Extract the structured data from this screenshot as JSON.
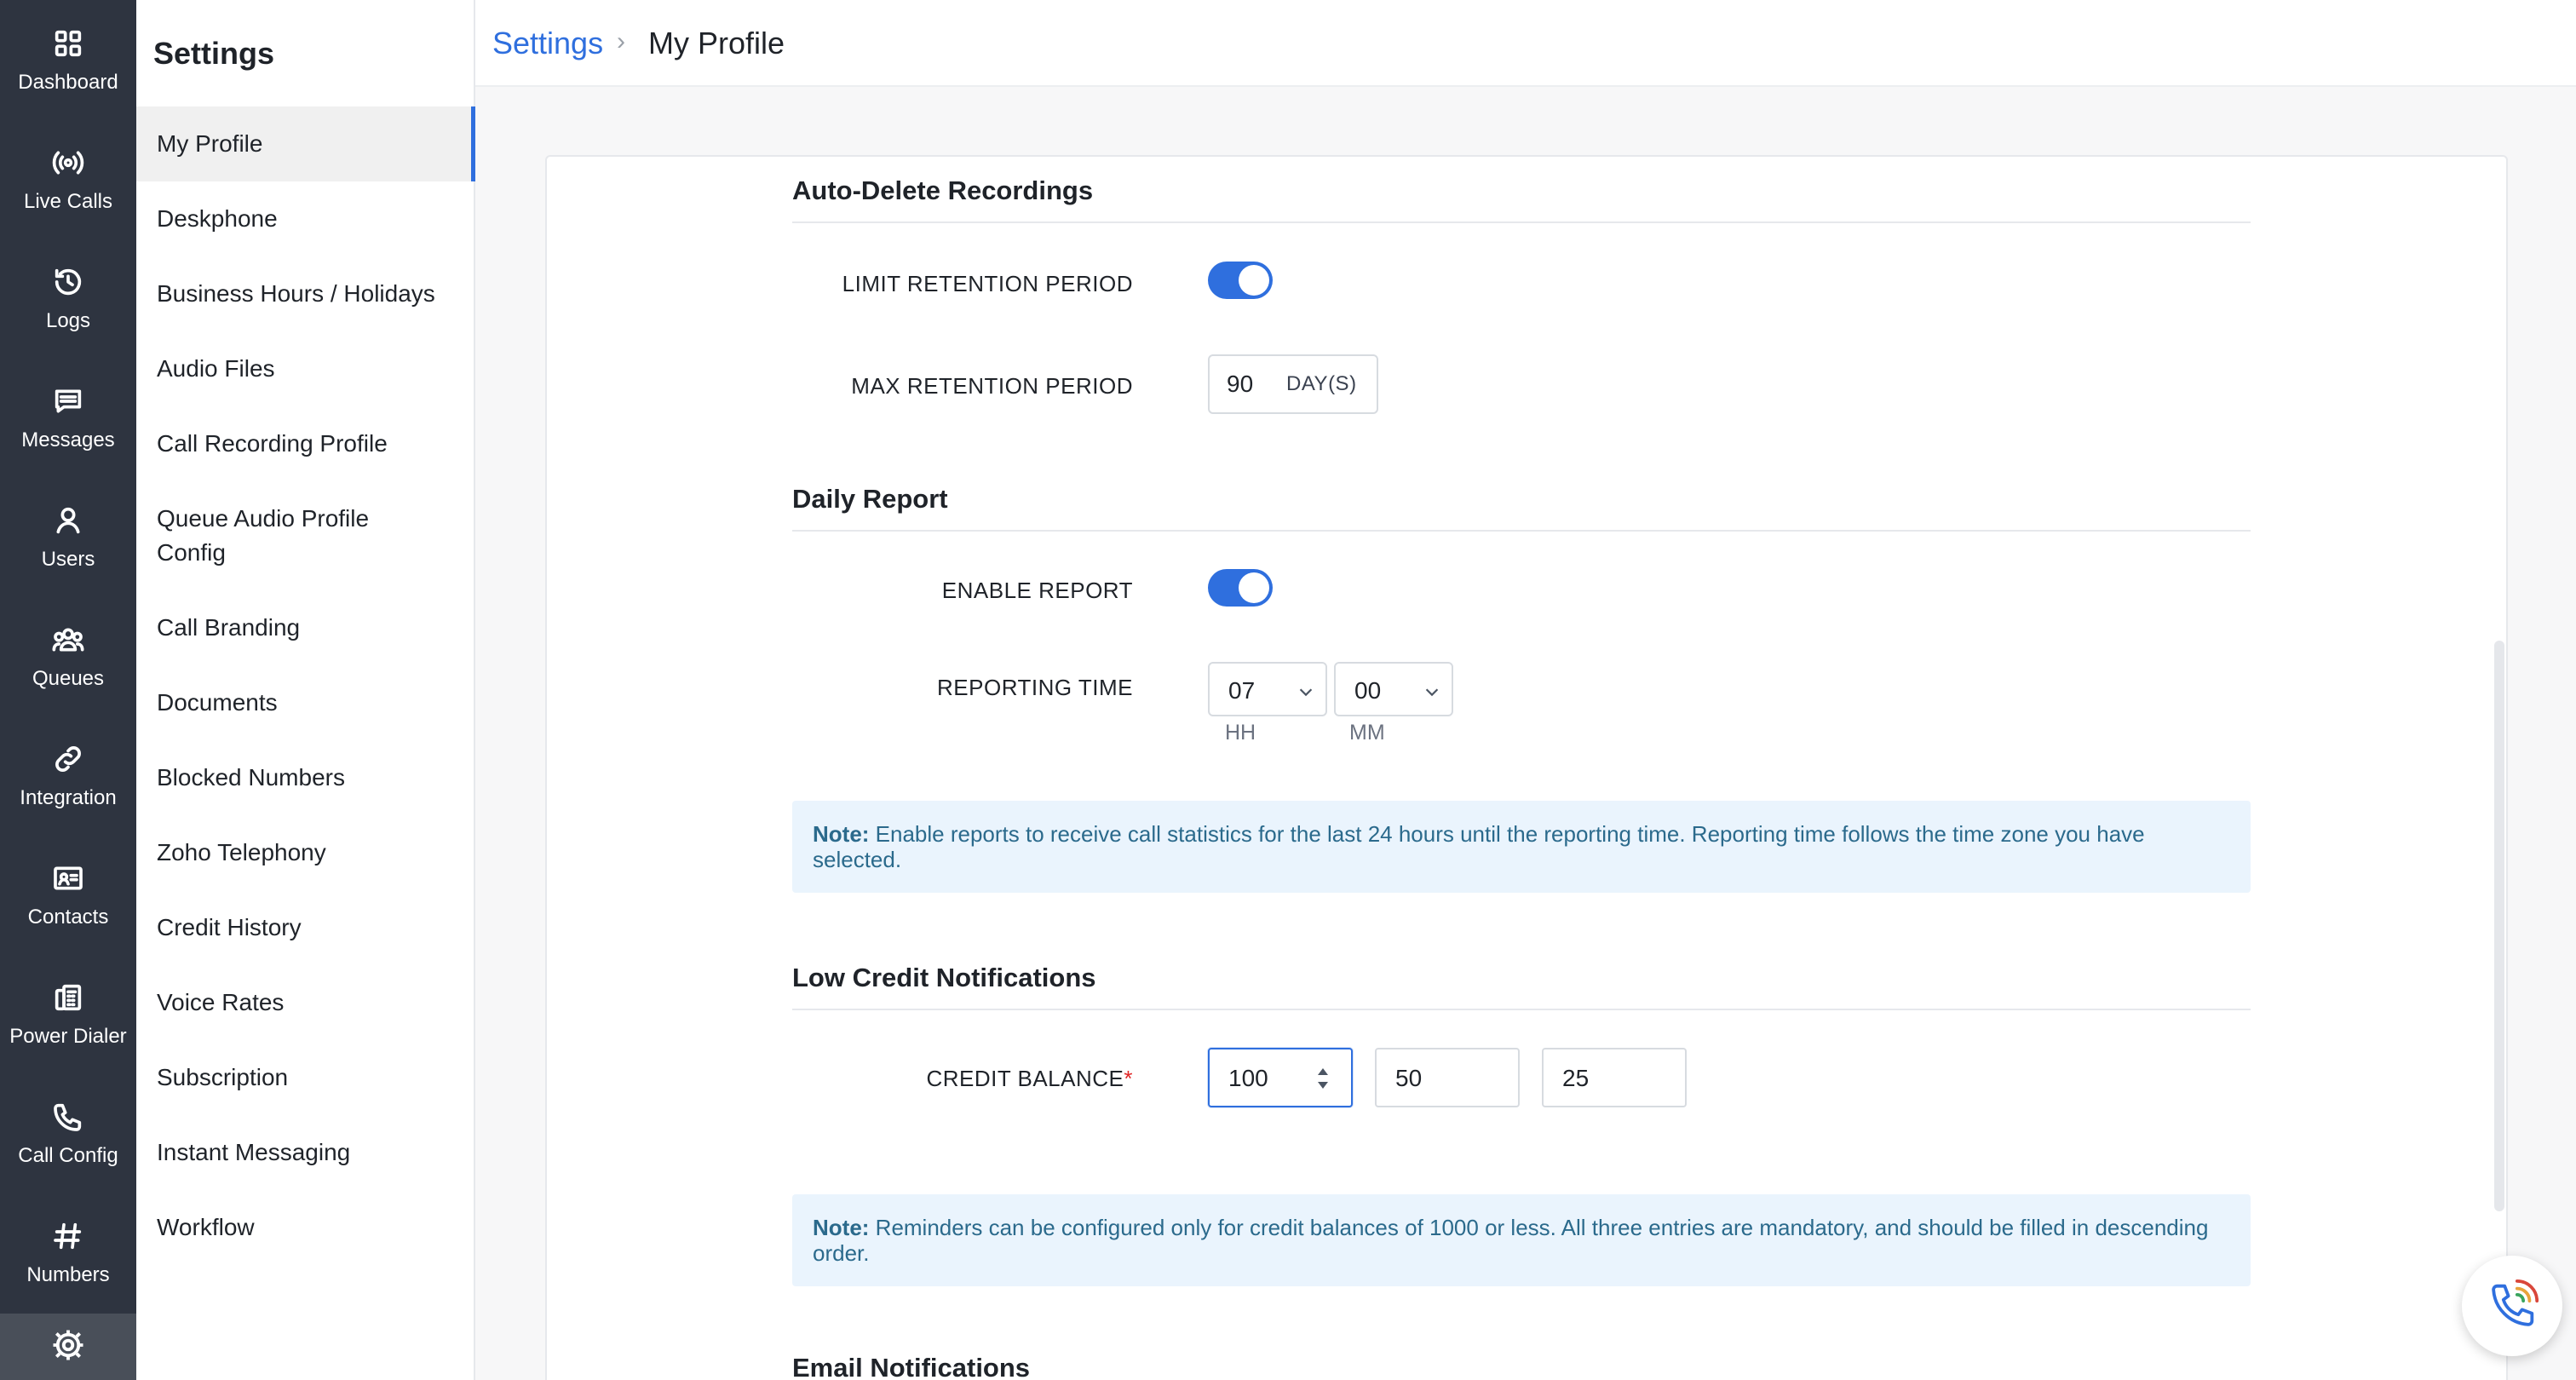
{
  "rail": {
    "items": [
      {
        "label": "Dashboard",
        "icon": "grid-icon"
      },
      {
        "label": "Live Calls",
        "icon": "broadcast-icon"
      },
      {
        "label": "Logs",
        "icon": "history-icon"
      },
      {
        "label": "Messages",
        "icon": "message-icon"
      },
      {
        "label": "Users",
        "icon": "user-icon"
      },
      {
        "label": "Queues",
        "icon": "group-icon"
      },
      {
        "label": "Integration",
        "icon": "link-icon"
      },
      {
        "label": "Contacts",
        "icon": "contact-card-icon"
      },
      {
        "label": "Power Dialer",
        "icon": "power-dialer-icon"
      },
      {
        "label": "Call Config",
        "icon": "phone-icon"
      },
      {
        "label": "Numbers",
        "icon": "hash-icon"
      }
    ],
    "settings_icon": "gear-icon"
  },
  "settings_nav": {
    "title": "Settings",
    "items": [
      "My Profile",
      "Deskphone",
      "Business Hours / Holidays",
      "Audio Files",
      "Call Recording Profile",
      "Queue Audio Profile Config",
      "Call Branding",
      "Documents",
      "Blocked Numbers",
      "Zoho Telephony",
      "Credit History",
      "Voice Rates",
      "Subscription",
      "Instant Messaging",
      "Workflow"
    ],
    "active": "My Profile"
  },
  "header": {
    "breadcrumb_root": "Settings",
    "breadcrumb_sep": "›",
    "breadcrumb_current": "My Profile"
  },
  "auto_delete": {
    "title": "Auto-Delete Recordings",
    "limit_label": "LIMIT RETENTION PERIOD",
    "limit_enabled": true,
    "max_label": "MAX RETENTION PERIOD",
    "max_value": "90",
    "max_unit": "DAY(S)"
  },
  "daily_report": {
    "title": "Daily Report",
    "enable_label": "ENABLE REPORT",
    "enable_enabled": true,
    "time_label": "REPORTING TIME",
    "hour": "07",
    "minute": "00",
    "hour_label": "HH",
    "minute_label": "MM",
    "note_prefix": "Note:",
    "note_text": " Enable reports to receive call statistics for the last 24 hours until the reporting time. Reporting time follows the time zone you have selected."
  },
  "low_credit": {
    "title": "Low Credit Notifications",
    "balance_label": "CREDIT BALANCE",
    "required_mark": "*",
    "values": [
      "100",
      "50",
      "25"
    ],
    "note_prefix": "Note:",
    "note_text": " Reminders can be configured only for credit balances of 1000 or less. All three entries are mandatory, and should be filled in descending order."
  },
  "email_notifications": {
    "title": "Email Notifications"
  },
  "colors": {
    "accent": "#2f6fde",
    "rail_bg": "#2e3440",
    "note_bg": "#eaf4fd",
    "note_text": "#2b6a8c"
  }
}
